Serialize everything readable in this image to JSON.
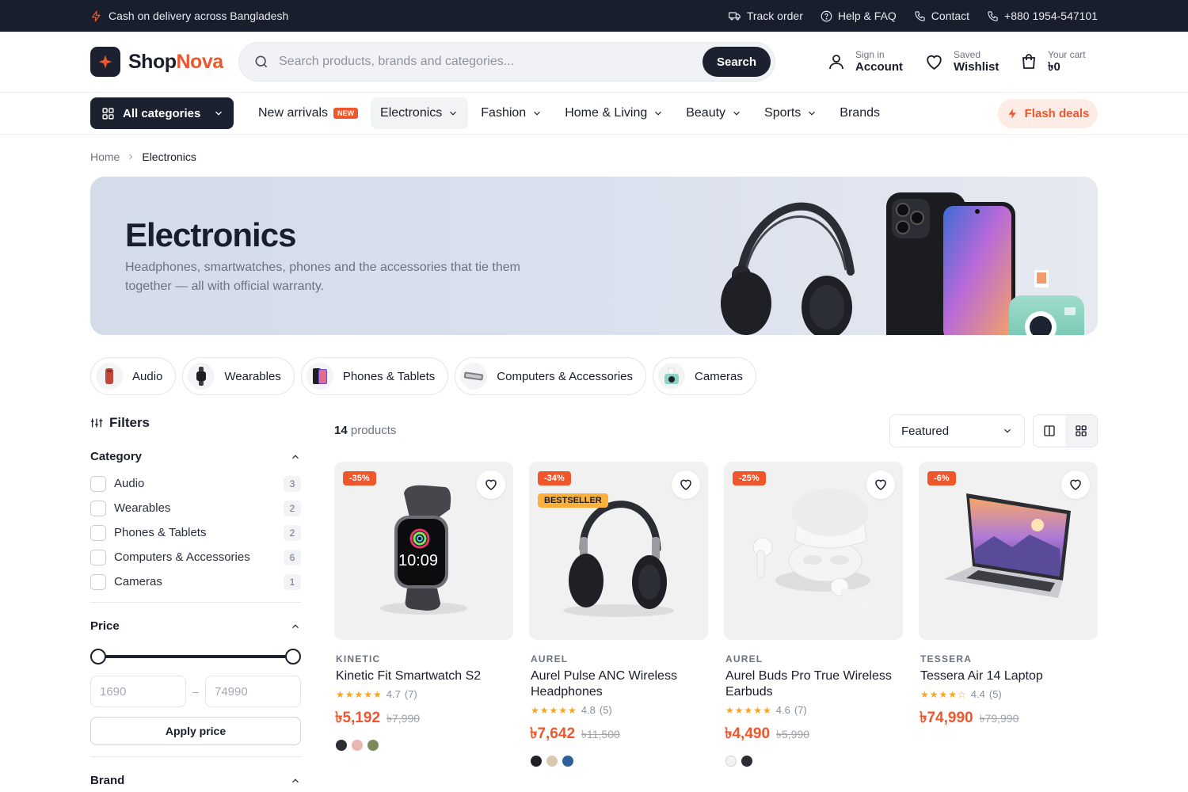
{
  "topbar": {
    "promo": "Cash on delivery across Bangladesh",
    "links": [
      "Track order",
      "Help & FAQ",
      "Contact",
      "+880 1954-547101"
    ]
  },
  "header": {
    "logo_part1": "Shop",
    "logo_part2": "Nova",
    "search_placeholder": "Search products, brands and categories...",
    "search_button": "Search",
    "account_small": "Sign in",
    "account_large": "Account",
    "wishlist_small": "Saved",
    "wishlist_large": "Wishlist",
    "cart_small": "Your cart",
    "cart_large": "৳0"
  },
  "nav": {
    "all_categories": "All categories",
    "items": [
      {
        "label": "New arrivals",
        "badge": "NEW"
      },
      {
        "label": "Electronics"
      },
      {
        "label": "Fashion"
      },
      {
        "label": "Home & Living"
      },
      {
        "label": "Beauty"
      },
      {
        "label": "Sports"
      },
      {
        "label": "Brands"
      }
    ],
    "flash": "Flash deals"
  },
  "breadcrumb": {
    "home": "Home",
    "current": "Electronics"
  },
  "hero": {
    "title": "Electronics",
    "subtitle": "Headphones, smartwatches, phones and the accessories that tie them together — all with official warranty."
  },
  "chips": [
    "Audio",
    "Wearables",
    "Phones & Tablets",
    "Computers & Accessories",
    "Cameras"
  ],
  "filters": {
    "title": "Filters",
    "category_title": "Category",
    "categories": [
      {
        "label": "Audio",
        "count": "3"
      },
      {
        "label": "Wearables",
        "count": "2"
      },
      {
        "label": "Phones & Tablets",
        "count": "2"
      },
      {
        "label": "Computers & Accessories",
        "count": "6"
      },
      {
        "label": "Cameras",
        "count": "1"
      }
    ],
    "price_title": "Price",
    "price_min": "1690",
    "price_max": "74990",
    "price_sep": "–",
    "apply": "Apply price",
    "brand_title": "Brand"
  },
  "toolbar": {
    "count": "14",
    "count_label": "products",
    "sort": "Featured"
  },
  "products": [
    {
      "discount": "-35%",
      "brand": "KINETIC",
      "name": "Kinetic Fit Smartwatch S2",
      "rating": "4.7",
      "reviews": "(7)",
      "price": "৳5,192",
      "old": "৳7,990",
      "colors": [
        "#2b2d33",
        "#e9b7b3",
        "#7b8a5c"
      ]
    },
    {
      "discount": "-34%",
      "badge": "BESTSELLER",
      "brand": "AUREL",
      "name": "Aurel Pulse ANC Wireless Headphones",
      "rating": "4.8",
      "reviews": "(5)",
      "price": "৳7,642",
      "old": "৳11,500",
      "colors": [
        "#1f2126",
        "#d8c8ad",
        "#2e5f9a"
      ]
    },
    {
      "discount": "-25%",
      "brand": "AUREL",
      "name": "Aurel Buds Pro True Wireless Earbuds",
      "rating": "4.6",
      "reviews": "(7)",
      "price": "৳4,490",
      "old": "৳5,990",
      "colors": [
        "#f3f3f3",
        "#2b2d33"
      ]
    },
    {
      "discount": "-6%",
      "brand": "TESSERA",
      "name": "Tessera Air 14 Laptop",
      "rating": "4.4",
      "reviews": "(5)",
      "price": "৳74,990",
      "old": "৳79,990",
      "colors": []
    }
  ]
}
